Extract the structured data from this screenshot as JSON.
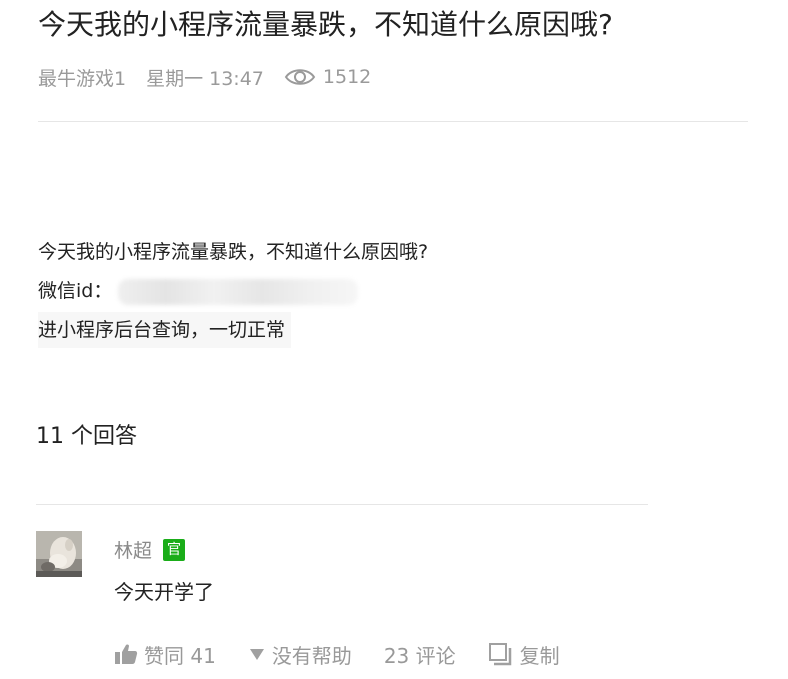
{
  "question": {
    "title": "今天我的小程序流量暴跌，不知道什么原因哦?",
    "author": "最牛游戏1",
    "time": "星期一 13:47",
    "views": "1512",
    "body": {
      "line1": "今天我的小程序流量暴跌，不知道什么原因哦?",
      "line2_label": "微信id：",
      "line3": "进小程序后台查询，一切正常"
    }
  },
  "answers": {
    "count_label": "11 个回答",
    "items": [
      {
        "author": "林超",
        "badge": "官",
        "text": "今天开学了",
        "actions": {
          "like_label": "赞同 41",
          "unhelpful_label": "没有帮助",
          "comments_label": "23 评论",
          "copy_label": "复制"
        }
      }
    ]
  },
  "colors": {
    "badge_green": "#1aad19",
    "meta_gray": "#9a9a9a"
  }
}
